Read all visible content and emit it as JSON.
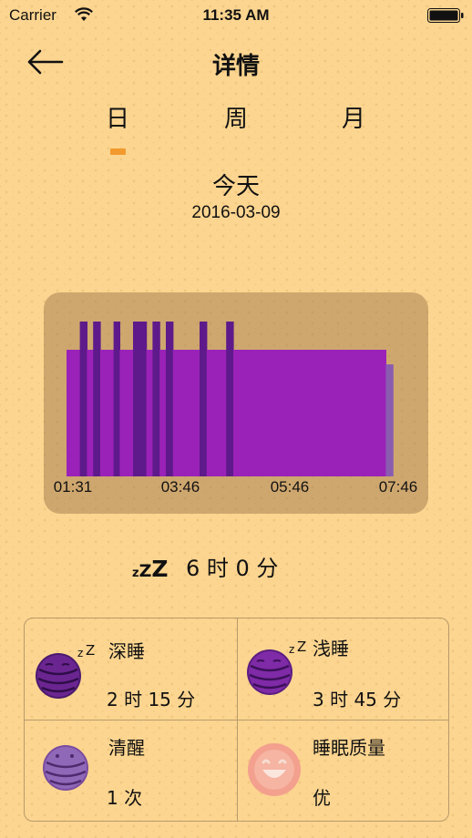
{
  "status_bar": {
    "carrier": "Carrier",
    "time": "11:35 AM"
  },
  "nav": {
    "title": "详情"
  },
  "tabs": [
    {
      "label": "日",
      "selected": true
    },
    {
      "label": "周",
      "selected": false
    },
    {
      "label": "月",
      "selected": false
    }
  ],
  "date": {
    "label": "今天",
    "value": "2016-03-09"
  },
  "colors": {
    "deep_sleep": "#5e1a8a",
    "light_sleep": "#9a22b8",
    "awake": "#8a5cb0",
    "accent": "#f29a2e"
  },
  "chart_data": {
    "type": "bar",
    "x_start": "01:31",
    "x_end": "07:46",
    "tick_labels": [
      "01:31",
      "03:46",
      "05:46",
      "07:46"
    ],
    "segments": [
      {
        "start": "01:31",
        "end": "01:46",
        "stage": "light"
      },
      {
        "start": "01:46",
        "end": "01:54",
        "stage": "deep"
      },
      {
        "start": "01:54",
        "end": "02:01",
        "stage": "light"
      },
      {
        "start": "02:01",
        "end": "02:09",
        "stage": "deep"
      },
      {
        "start": "02:09",
        "end": "02:24",
        "stage": "light"
      },
      {
        "start": "02:24",
        "end": "02:31",
        "stage": "deep"
      },
      {
        "start": "02:31",
        "end": "02:46",
        "stage": "light"
      },
      {
        "start": "02:46",
        "end": "03:01",
        "stage": "deep"
      },
      {
        "start": "03:01",
        "end": "03:08",
        "stage": "light"
      },
      {
        "start": "03:08",
        "end": "03:16",
        "stage": "deep"
      },
      {
        "start": "03:16",
        "end": "03:23",
        "stage": "light"
      },
      {
        "start": "03:23",
        "end": "03:31",
        "stage": "deep"
      },
      {
        "start": "03:31",
        "end": "04:01",
        "stage": "light"
      },
      {
        "start": "04:01",
        "end": "04:09",
        "stage": "deep"
      },
      {
        "start": "04:09",
        "end": "04:31",
        "stage": "light"
      },
      {
        "start": "04:31",
        "end": "04:39",
        "stage": "deep"
      },
      {
        "start": "04:39",
        "end": "07:31",
        "stage": "light"
      },
      {
        "start": "07:31",
        "end": "07:39",
        "stage": "awake"
      }
    ]
  },
  "total": {
    "zzz": "zZZ",
    "duration": "6 时 0 分"
  },
  "stats": [
    {
      "label": "深睡",
      "value": "2 时 15 分",
      "icon": "deep-sleep-ball-icon"
    },
    {
      "label": "浅睡",
      "value": "3 时 45 分",
      "icon": "light-sleep-ball-icon"
    },
    {
      "label": "清醒",
      "value": "1 次",
      "icon": "awake-ball-icon"
    },
    {
      "label": "睡眠质量",
      "value": "优",
      "icon": "smile-face-icon"
    }
  ]
}
